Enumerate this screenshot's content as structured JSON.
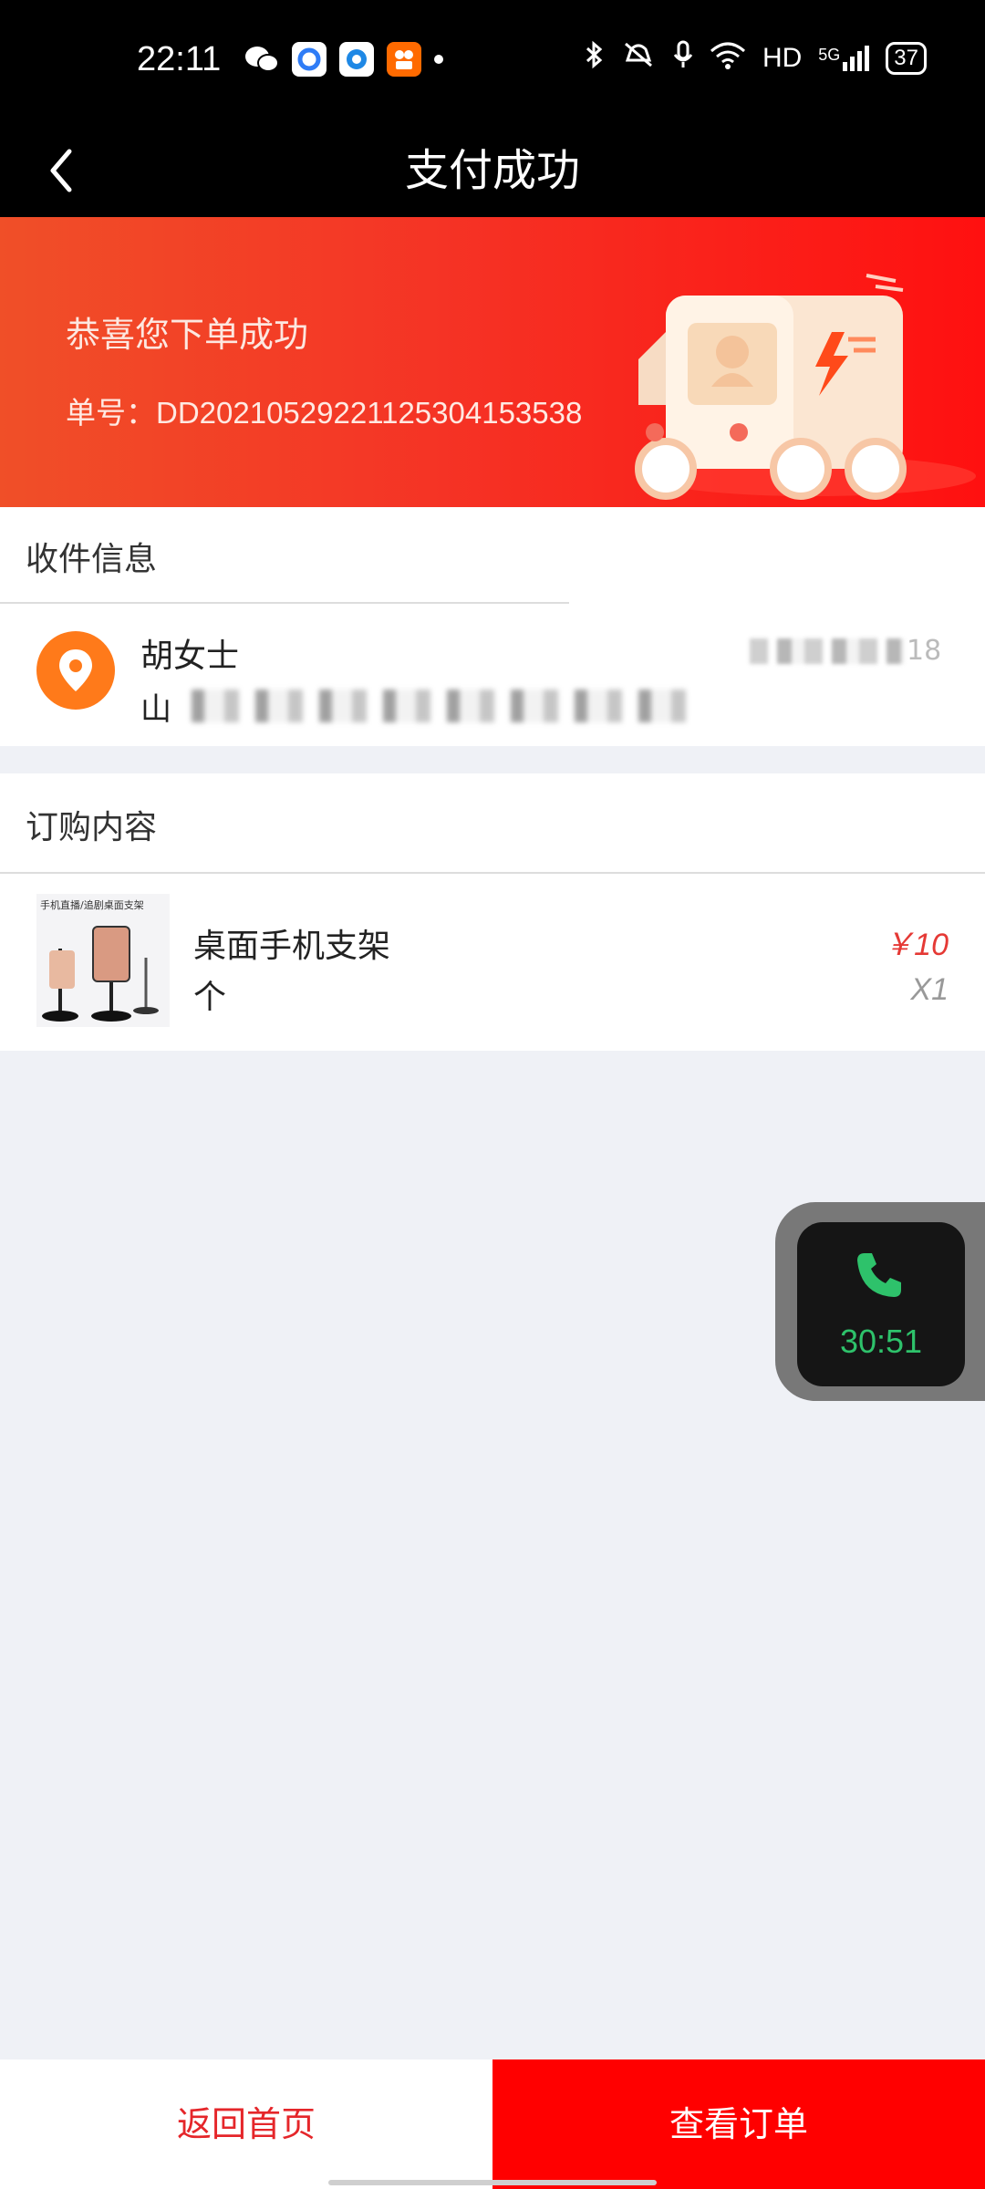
{
  "status_bar": {
    "time": "22:11",
    "network": "HD",
    "signal": "5G",
    "battery": "37"
  },
  "nav": {
    "title": "支付成功"
  },
  "banner": {
    "message": "恭喜您下单成功",
    "order_number": "单号：DD20210529221125304153538"
  },
  "receiver": {
    "section_title": "收件信息",
    "name": "胡女士",
    "address_start": "山",
    "phone_tail": "18"
  },
  "order": {
    "section_title": "订购内容",
    "item_name": "桌面手机支架",
    "item_unit": "个",
    "price": "￥10",
    "quantity": "X1",
    "thumbnail_text": "手机直播/追剧桌面支架"
  },
  "call_widget": {
    "time": "30:51"
  },
  "buttons": {
    "home": "返回首页",
    "view_order": "查看订单"
  },
  "colors": {
    "accent": "#ff0000",
    "call_green": "#2ec26b"
  }
}
